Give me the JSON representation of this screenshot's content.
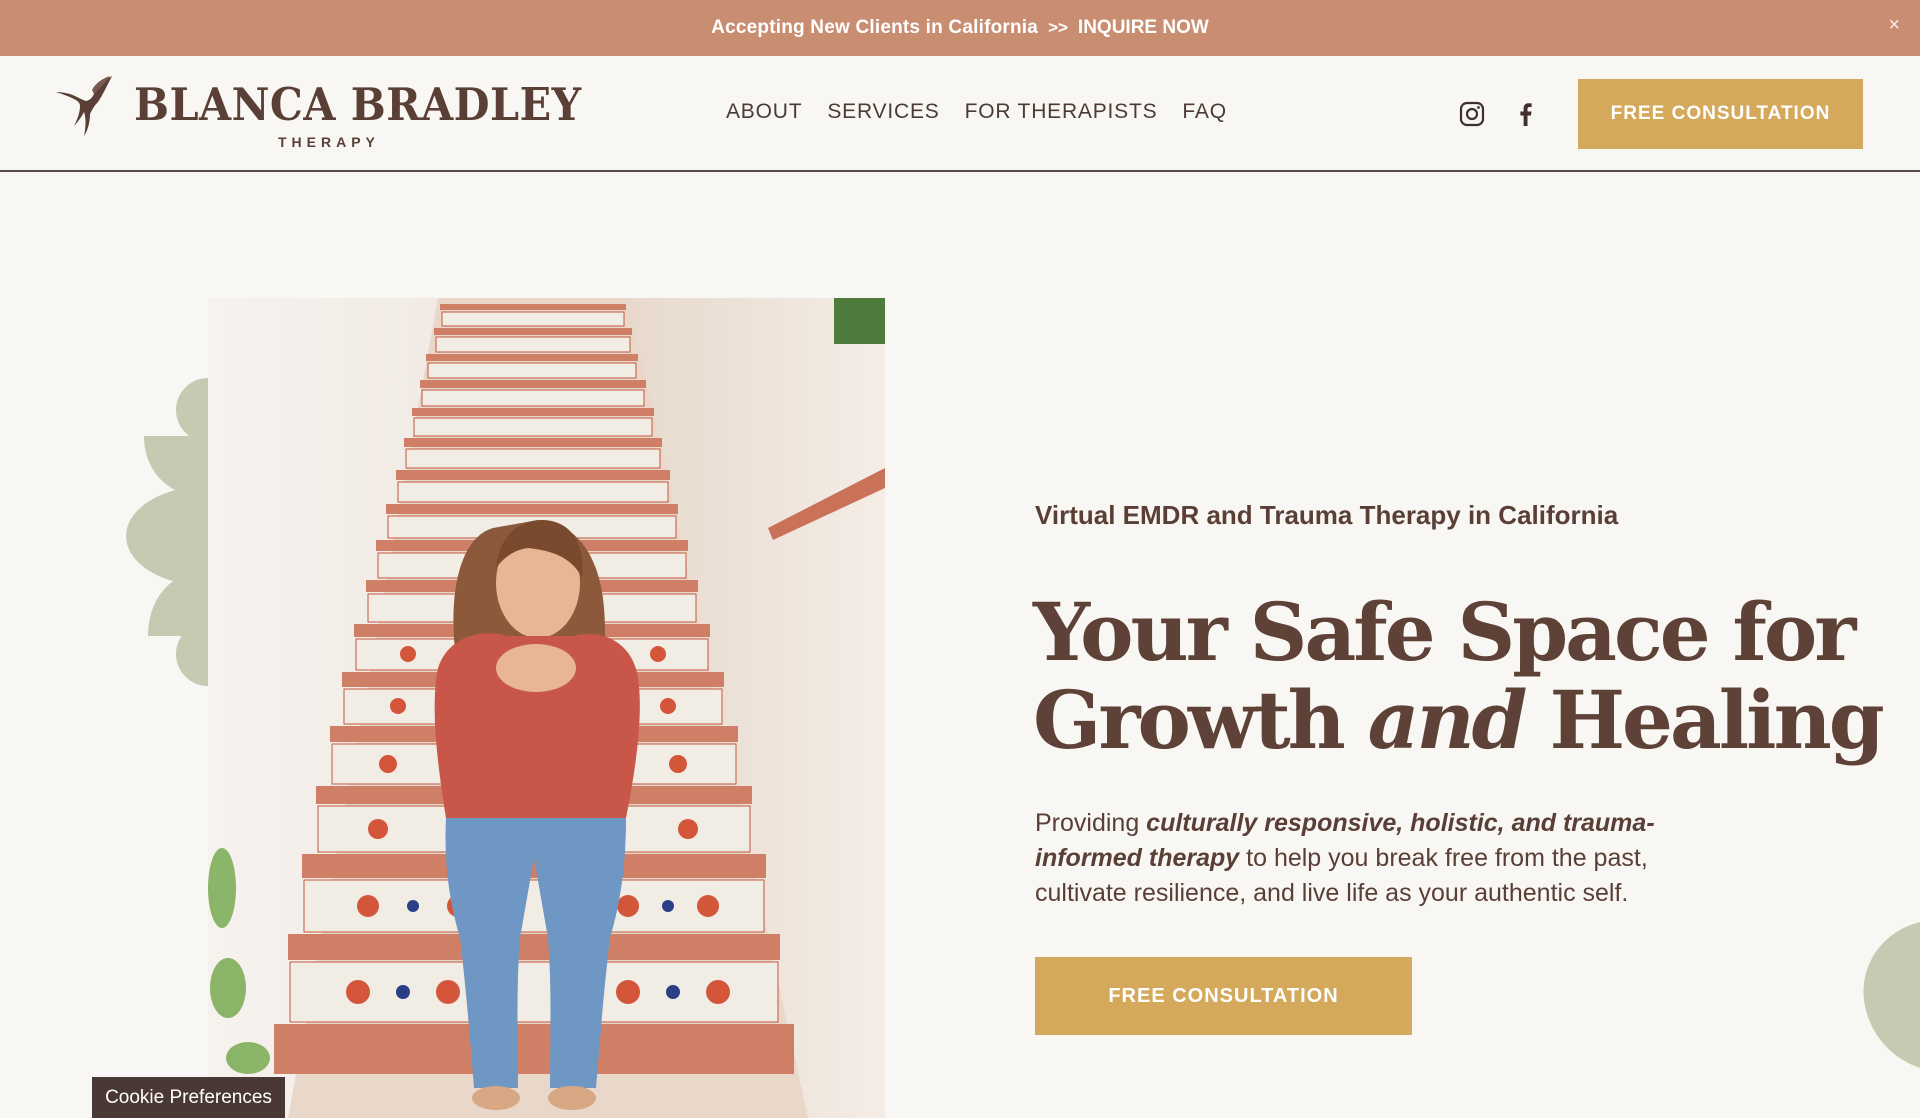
{
  "announcement": {
    "text": "Accepting New Clients in California",
    "separator": ">>",
    "link_label": "INQUIRE NOW",
    "close_label": "×"
  },
  "header": {
    "logo_name": "BLANCA BRADLEY",
    "logo_sub": "THERAPY",
    "nav": [
      {
        "label": "ABOUT"
      },
      {
        "label": "SERVICES"
      },
      {
        "label": "FOR THERAPISTS"
      },
      {
        "label": "FAQ"
      }
    ],
    "social_icons": [
      "instagram-icon",
      "facebook-icon"
    ],
    "cta_label": "FREE CONSULTATION"
  },
  "hero": {
    "kicker": "Virtual EMDR and Trauma Therapy in California",
    "title_line1": "Your Safe Space for",
    "title_line2_a": "Growth ",
    "title_line2_em": "and",
    "title_line2_b": " Healing",
    "body_a": "Providing ",
    "body_bold": "culturally responsive, holistic, and trauma-informed therapy",
    "body_b": " to help you break free from the past, cultivate resilience, and live life as your authentic self.",
    "cta_label": "FREE CONSULTATION"
  },
  "cookie": {
    "label": "Cookie Preferences"
  },
  "colors": {
    "announcement_bg": "#c98d72",
    "gold": "#d4a95b",
    "brown": "#5a3f36",
    "sage": "#c8c9b3",
    "page_bg": "#f9f7f3"
  }
}
